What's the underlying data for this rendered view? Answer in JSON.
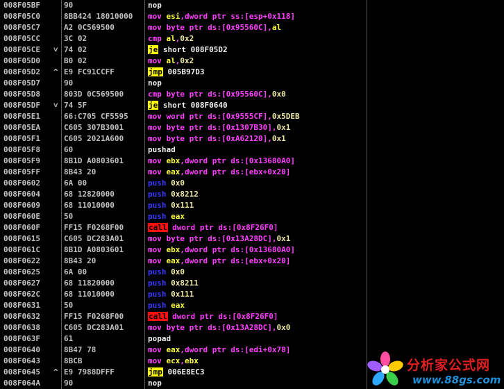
{
  "rows": [
    {
      "address": "008F05BF",
      "mark": "",
      "hex": "90",
      "disasm": [
        {
          "t": "nop",
          "c": "c-nop"
        }
      ]
    },
    {
      "address": "008F05C0",
      "mark": "",
      "hex": "8BB424 18010000",
      "disasm": [
        {
          "t": "mov ",
          "c": "c-mov"
        },
        {
          "t": "esi",
          "c": "c-reg"
        },
        {
          "t": ",",
          "c": "c-mov"
        },
        {
          "t": "dword ptr ss:[esp+0x118]",
          "c": "c-mem"
        }
      ]
    },
    {
      "address": "008F05C7",
      "mark": "",
      "hex": "A2 0C569500",
      "disasm": [
        {
          "t": "mov ",
          "c": "c-mov"
        },
        {
          "t": "byte ptr ds:[0x95560C]",
          "c": "c-mem"
        },
        {
          "t": ",",
          "c": "c-mov"
        },
        {
          "t": "al",
          "c": "c-reg"
        }
      ]
    },
    {
      "address": "008F05CC",
      "mark": "",
      "hex": "3C 02",
      "disasm": [
        {
          "t": "cmp ",
          "c": "c-cmp"
        },
        {
          "t": "al",
          "c": "c-reg"
        },
        {
          "t": ",",
          "c": "c-mov"
        },
        {
          "t": "0x2",
          "c": "c-imm"
        }
      ]
    },
    {
      "address": "008F05CE",
      "mark": "˅",
      "hex": "74 02",
      "disasm": [
        {
          "t": "je",
          "c": "c-jcc"
        },
        {
          "t": " short 008F05D2",
          "c": "c-target"
        }
      ]
    },
    {
      "address": "008F05D0",
      "mark": "",
      "hex": "B0 02",
      "disasm": [
        {
          "t": "mov ",
          "c": "c-mov"
        },
        {
          "t": "al",
          "c": "c-reg"
        },
        {
          "t": ",",
          "c": "c-mov"
        },
        {
          "t": "0x2",
          "c": "c-imm"
        }
      ]
    },
    {
      "address": "008F05D2",
      "mark": "^",
      "hex": "E9 FC91CCFF",
      "disasm": [
        {
          "t": "jmp",
          "c": "c-jmp"
        },
        {
          "t": " 005B97D3",
          "c": "c-target"
        }
      ]
    },
    {
      "address": "008F05D7",
      "mark": "",
      "hex": "90",
      "disasm": [
        {
          "t": "nop",
          "c": "c-nop"
        }
      ]
    },
    {
      "address": "008F05D8",
      "mark": "",
      "hex": "803D 0C569500",
      "disasm": [
        {
          "t": "cmp ",
          "c": "c-cmp"
        },
        {
          "t": "byte ptr ds:[0x95560C]",
          "c": "c-mem"
        },
        {
          "t": ",",
          "c": "c-mov"
        },
        {
          "t": "0x0",
          "c": "c-imm"
        }
      ]
    },
    {
      "address": "008F05DF",
      "mark": "˅",
      "hex": "74 5F",
      "disasm": [
        {
          "t": "je",
          "c": "c-jcc"
        },
        {
          "t": " short 008F0640",
          "c": "c-target"
        }
      ]
    },
    {
      "address": "008F05E1",
      "mark": "",
      "hex": "66:C705 CF5595",
      "disasm": [
        {
          "t": "mov ",
          "c": "c-mov"
        },
        {
          "t": "word ptr ds:[0x9555CF]",
          "c": "c-mem"
        },
        {
          "t": ",",
          "c": "c-mov"
        },
        {
          "t": "0x5DEB",
          "c": "c-imm"
        }
      ]
    },
    {
      "address": "008F05EA",
      "mark": "",
      "hex": "C605 307B3001",
      "disasm": [
        {
          "t": "mov ",
          "c": "c-mov"
        },
        {
          "t": "byte ptr ds:[0x1307B30]",
          "c": "c-mem"
        },
        {
          "t": ",",
          "c": "c-mov"
        },
        {
          "t": "0x1",
          "c": "c-imm"
        }
      ]
    },
    {
      "address": "008F05F1",
      "mark": "",
      "hex": "C605 2021A600",
      "disasm": [
        {
          "t": "mov ",
          "c": "c-mov"
        },
        {
          "t": "byte ptr ds:[0xA62120]",
          "c": "c-mem"
        },
        {
          "t": ",",
          "c": "c-mov"
        },
        {
          "t": "0x1",
          "c": "c-imm"
        }
      ]
    },
    {
      "address": "008F05F8",
      "mark": "",
      "hex": "60",
      "disasm": [
        {
          "t": "pushad",
          "c": "c-pushad"
        }
      ]
    },
    {
      "address": "008F05F9",
      "mark": "",
      "hex": "8B1D A0803601",
      "disasm": [
        {
          "t": "mov ",
          "c": "c-mov"
        },
        {
          "t": "ebx",
          "c": "c-reg"
        },
        {
          "t": ",",
          "c": "c-mov"
        },
        {
          "t": "dword ptr ds:[0x13680A0]",
          "c": "c-mem"
        }
      ]
    },
    {
      "address": "008F05FF",
      "mark": "",
      "hex": "8B43 20",
      "disasm": [
        {
          "t": "mov ",
          "c": "c-mov"
        },
        {
          "t": "eax",
          "c": "c-reg"
        },
        {
          "t": ",",
          "c": "c-mov"
        },
        {
          "t": "dword ptr ds:[ebx+0x20]",
          "c": "c-mem"
        }
      ]
    },
    {
      "address": "008F0602",
      "mark": "",
      "hex": "6A 00",
      "disasm": [
        {
          "t": "push ",
          "c": "c-push"
        },
        {
          "t": "0x0",
          "c": "c-imm"
        }
      ]
    },
    {
      "address": "008F0604",
      "mark": "",
      "hex": "68 12820000",
      "disasm": [
        {
          "t": "push ",
          "c": "c-push"
        },
        {
          "t": "0x8212",
          "c": "c-imm"
        }
      ]
    },
    {
      "address": "008F0609",
      "mark": "",
      "hex": "68 11010000",
      "disasm": [
        {
          "t": "push ",
          "c": "c-push"
        },
        {
          "t": "0x111",
          "c": "c-imm"
        }
      ]
    },
    {
      "address": "008F060E",
      "mark": "",
      "hex": "50",
      "disasm": [
        {
          "t": "push ",
          "c": "c-push"
        },
        {
          "t": "eax",
          "c": "c-reg"
        }
      ]
    },
    {
      "address": "008F060F",
      "mark": "",
      "hex": "FF15 F0268F00",
      "disasm": [
        {
          "t": "call",
          "c": "c-call"
        },
        {
          "t": " dword ptr ds:[0x8F26F0]",
          "c": "c-mem"
        }
      ]
    },
    {
      "address": "008F0615",
      "mark": "",
      "hex": "C605 DC283A01",
      "disasm": [
        {
          "t": "mov ",
          "c": "c-mov"
        },
        {
          "t": "byte ptr ds:[0x13A28DC]",
          "c": "c-mem"
        },
        {
          "t": ",",
          "c": "c-mov"
        },
        {
          "t": "0x1",
          "c": "c-imm"
        }
      ]
    },
    {
      "address": "008F061C",
      "mark": "",
      "hex": "8B1D A0803601",
      "disasm": [
        {
          "t": "mov ",
          "c": "c-mov"
        },
        {
          "t": "ebx",
          "c": "c-reg"
        },
        {
          "t": ",",
          "c": "c-mov"
        },
        {
          "t": "dword ptr ds:[0x13680A0]",
          "c": "c-mem"
        }
      ]
    },
    {
      "address": "008F0622",
      "mark": "",
      "hex": "8B43 20",
      "disasm": [
        {
          "t": "mov ",
          "c": "c-mov"
        },
        {
          "t": "eax",
          "c": "c-reg"
        },
        {
          "t": ",",
          "c": "c-mov"
        },
        {
          "t": "dword ptr ds:[ebx+0x20]",
          "c": "c-mem"
        }
      ]
    },
    {
      "address": "008F0625",
      "mark": "",
      "hex": "6A 00",
      "disasm": [
        {
          "t": "push ",
          "c": "c-push"
        },
        {
          "t": "0x0",
          "c": "c-imm"
        }
      ]
    },
    {
      "address": "008F0627",
      "mark": "",
      "hex": "68 11820000",
      "disasm": [
        {
          "t": "push ",
          "c": "c-push"
        },
        {
          "t": "0x8211",
          "c": "c-imm"
        }
      ]
    },
    {
      "address": "008F062C",
      "mark": "",
      "hex": "68 11010000",
      "disasm": [
        {
          "t": "push ",
          "c": "c-push"
        },
        {
          "t": "0x111",
          "c": "c-imm"
        }
      ]
    },
    {
      "address": "008F0631",
      "mark": "",
      "hex": "50",
      "disasm": [
        {
          "t": "push ",
          "c": "c-push"
        },
        {
          "t": "eax",
          "c": "c-reg"
        }
      ]
    },
    {
      "address": "008F0632",
      "mark": "",
      "hex": "FF15 F0268F00",
      "disasm": [
        {
          "t": "call",
          "c": "c-call"
        },
        {
          "t": " dword ptr ds:[0x8F26F0]",
          "c": "c-mem"
        }
      ]
    },
    {
      "address": "008F0638",
      "mark": "",
      "hex": "C605 DC283A01",
      "disasm": [
        {
          "t": "mov ",
          "c": "c-mov"
        },
        {
          "t": "byte ptr ds:[0x13A28DC]",
          "c": "c-mem"
        },
        {
          "t": ",",
          "c": "c-mov"
        },
        {
          "t": "0x0",
          "c": "c-imm"
        }
      ]
    },
    {
      "address": "008F063F",
      "mark": "",
      "hex": "61",
      "disasm": [
        {
          "t": "popad",
          "c": "c-popad"
        }
      ]
    },
    {
      "address": "008F0640",
      "mark": "",
      "hex": "8B47 78",
      "disasm": [
        {
          "t": "mov ",
          "c": "c-mov"
        },
        {
          "t": "eax",
          "c": "c-reg"
        },
        {
          "t": ",",
          "c": "c-mov"
        },
        {
          "t": "dword ptr ds:[edi+0x78]",
          "c": "c-mem"
        }
      ]
    },
    {
      "address": "008F0643",
      "mark": "",
      "hex": "8BCB",
      "disasm": [
        {
          "t": "mov ",
          "c": "c-mov"
        },
        {
          "t": "ecx",
          "c": "c-reg"
        },
        {
          "t": ",",
          "c": "c-mov"
        },
        {
          "t": "ebx",
          "c": "c-reg"
        }
      ]
    },
    {
      "address": "008F0645",
      "mark": "^",
      "hex": "E9 7988DFFF",
      "disasm": [
        {
          "t": "jmp",
          "c": "c-jmp"
        },
        {
          "t": " 006E8EC3",
          "c": "c-target"
        }
      ]
    },
    {
      "address": "008F064A",
      "mark": "",
      "hex": "90",
      "disasm": [
        {
          "t": "nop",
          "c": "c-nop"
        }
      ]
    }
  ],
  "watermark": {
    "site_name_cn": "分析家公式网",
    "site_url": "www.88gs.com"
  }
}
